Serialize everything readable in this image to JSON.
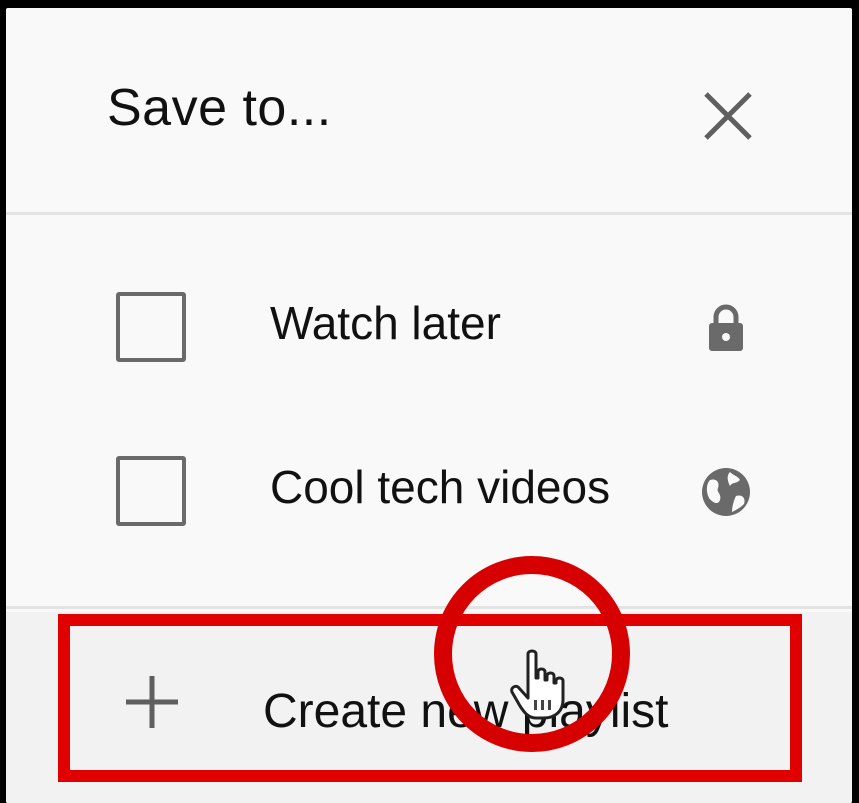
{
  "dialog": {
    "title": "Save to...",
    "close_icon": "close-icon"
  },
  "playlists": [
    {
      "label": "Watch later",
      "checked": false,
      "privacy_icon": "lock-icon"
    },
    {
      "label": "Cool tech videos",
      "checked": false,
      "privacy_icon": "globe-icon"
    }
  ],
  "create": {
    "label": "Create new playlist",
    "icon": "plus-icon"
  },
  "annotation": {
    "highlight_color": "#e00000"
  }
}
